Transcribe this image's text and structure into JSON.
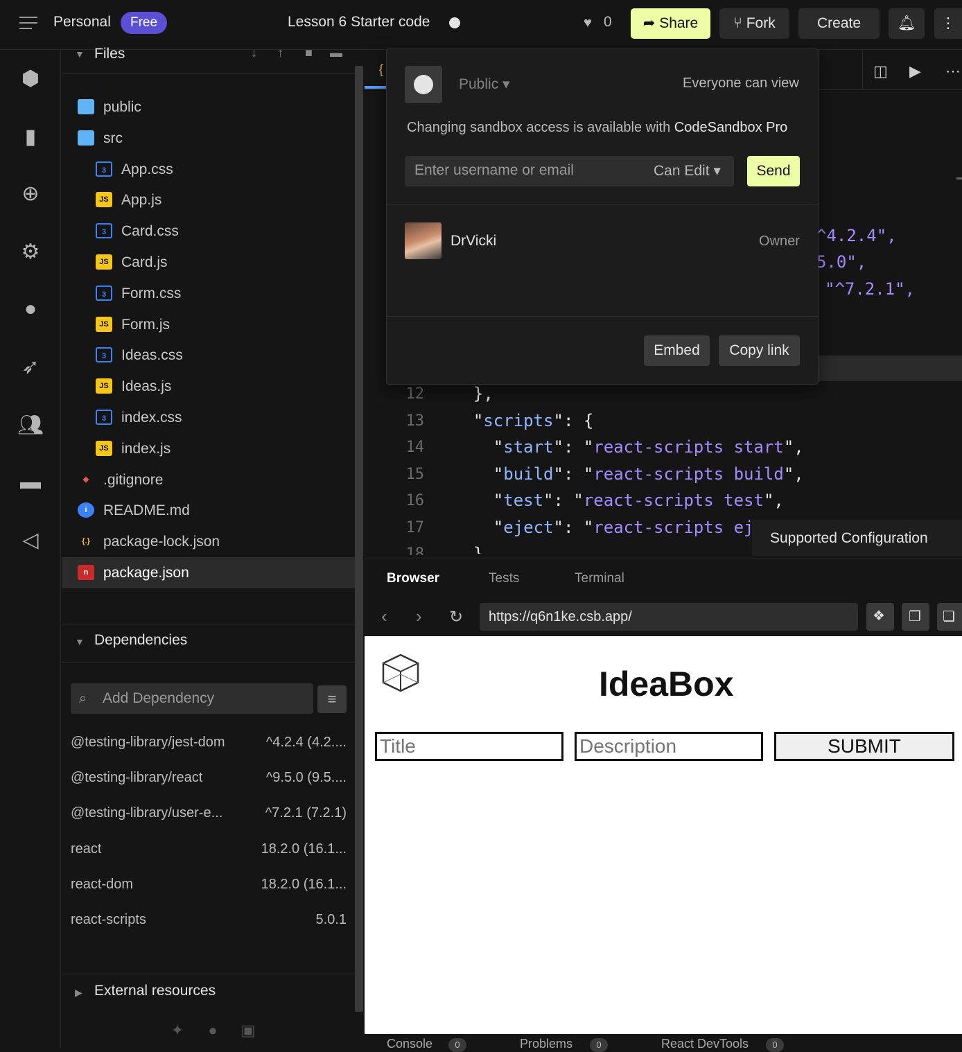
{
  "topbar": {
    "workspace": "Personal",
    "plan": "Free",
    "sandbox_title": "Lesson 6 Starter code",
    "likes": "0",
    "share": "Share",
    "fork": "Fork",
    "create": "Create"
  },
  "files": {
    "header": "Files",
    "items": [
      {
        "name": "public",
        "icon": "folder-icon"
      },
      {
        "name": "src",
        "icon": "folder-open-icon"
      },
      {
        "name": "App.css",
        "icon": "css-icon"
      },
      {
        "name": "App.js",
        "icon": "js-icon"
      },
      {
        "name": "Card.css",
        "icon": "css-icon"
      },
      {
        "name": "Card.js",
        "icon": "js-icon"
      },
      {
        "name": "Form.css",
        "icon": "css-icon"
      },
      {
        "name": "Form.js",
        "icon": "js-icon"
      },
      {
        "name": "Ideas.css",
        "icon": "css-icon"
      },
      {
        "name": "Ideas.js",
        "icon": "js-icon"
      },
      {
        "name": "index.css",
        "icon": "css-icon"
      },
      {
        "name": "index.js",
        "icon": "js-icon"
      },
      {
        "name": ".gitignore",
        "icon": "git-icon"
      },
      {
        "name": "README.md",
        "icon": "info-icon"
      },
      {
        "name": "package-lock.json",
        "icon": "json-icon"
      },
      {
        "name": "package.json",
        "icon": "npm-icon"
      }
    ]
  },
  "dependencies": {
    "header": "Dependencies",
    "search_placeholder": "Add Dependency",
    "items": [
      {
        "name": "@testing-library/jest-dom",
        "version": "^4.2.4 (4.2...."
      },
      {
        "name": "@testing-library/react",
        "version": "^9.5.0 (9.5...."
      },
      {
        "name": "@testing-library/user-e...",
        "version": "^7.2.1 (7.2.1)"
      },
      {
        "name": "react",
        "version": "18.2.0 (16.1..."
      },
      {
        "name": "react-dom",
        "version": "18.2.0 (16.1..."
      },
      {
        "name": "react-scripts",
        "version": "5.0.1"
      }
    ]
  },
  "external": {
    "header": "External resources"
  },
  "editor": {
    "partial_lines": [
      "^4.2.4\",",
      "5.0\",",
      "\"^7.2.1\","
    ],
    "lines": [
      {
        "n": "12",
        "text": "  },"
      },
      {
        "n": "13",
        "text": "  \"scripts\": {"
      },
      {
        "n": "14",
        "text": "    \"start\": \"react-scripts start\","
      },
      {
        "n": "15",
        "text": "    \"build\": \"react-scripts build\","
      },
      {
        "n": "16",
        "text": "    \"test\": \"react-scripts test\","
      },
      {
        "n": "17",
        "text": "    \"eject\": \"react-scripts eject\""
      },
      {
        "n": "18",
        "text": "  }"
      }
    ],
    "supported_config": "Supported Configuration"
  },
  "share_popover": {
    "access": "Public",
    "access_desc": "Everyone can view",
    "pro_notice_prefix": "Changing sandbox access is available with",
    "pro_notice_product": "CodeSandbox Pro",
    "invite_placeholder": "Enter username or email",
    "permission": "Can Edit",
    "send": "Send",
    "user": "DrVicki",
    "role": "Owner",
    "embed": "Embed",
    "copy_link": "Copy link"
  },
  "preview": {
    "tabs": [
      "Browser",
      "Tests",
      "Terminal"
    ],
    "url": "https://q6n1ke.csb.app/",
    "app_title": "IdeaBox",
    "title_placeholder": "Title",
    "description_placeholder": "Description",
    "submit": "SUBMIT",
    "console_tabs": [
      {
        "label": "Console",
        "count": "0"
      },
      {
        "label": "Problems",
        "count": "0"
      },
      {
        "label": "React DevTools",
        "count": "0"
      }
    ]
  },
  "colors": {
    "accent_yellow": "#edffa5",
    "badge_purple": "#5b4fd6",
    "css_blue": "#3b82f6",
    "js_yellow": "#f5c518",
    "string_purple": "#a48bff"
  }
}
